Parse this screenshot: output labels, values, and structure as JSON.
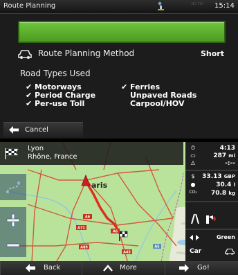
{
  "planning": {
    "status_bar": {
      "title": "Route Planning",
      "gps_text": "NO FIX",
      "time": "15:14"
    },
    "method": {
      "label": "Route Planning Method",
      "value": "Short"
    },
    "road_types": {
      "heading": "Road Types Used",
      "left": [
        {
          "label": "Motorways",
          "checked": true
        },
        {
          "label": "Period Charge",
          "checked": true
        },
        {
          "label": "Per-use Toll",
          "checked": true
        }
      ],
      "right": [
        {
          "label": "Ferries",
          "checked": true
        },
        {
          "label": "Unpaved Roads",
          "checked": false
        },
        {
          "label": "Carpool/HOV",
          "checked": false
        }
      ]
    },
    "cancel_label": "Cancel"
  },
  "route_map": {
    "destination": {
      "city": "Lyon",
      "region": "Rhône, France"
    },
    "map_labels": {
      "city": "aris",
      "road_a6": "A6",
      "road_a71": "A71",
      "road_a89": "A89",
      "road_a43": "A43",
      "road_a5": "A5"
    },
    "info": {
      "time": "4:13",
      "distance": "287",
      "distance_unit": "mi",
      "extra": "-:--",
      "cost_icon": "$",
      "cost": "33.13",
      "cost_unit": "GBP",
      "fuel": "30.4",
      "fuel_unit": "l",
      "co2_icon": "CO₂",
      "co2": "70.8",
      "co2_unit": "kg",
      "eco_label": "Green",
      "vehicle_label": "Car"
    },
    "buttons": {
      "back": "Back",
      "more": "More",
      "go": "Go!"
    }
  },
  "colors": {
    "progress_green": "#5cb030",
    "map_land": "#b9e39a",
    "route": "#d9301f",
    "roads": "#d05a3c",
    "panel_dark": "#1e1e1e"
  }
}
